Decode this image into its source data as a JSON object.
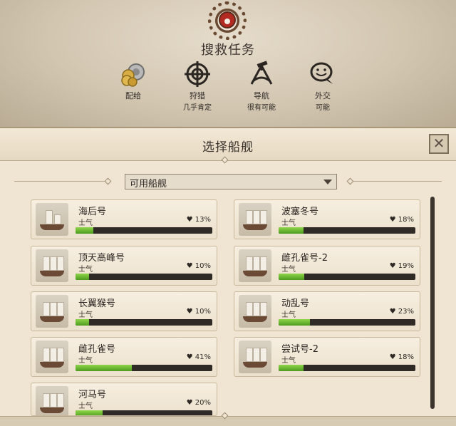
{
  "mission": {
    "title": "搜救任务",
    "stats": [
      {
        "label": "配给",
        "sub": "",
        "icon": "supplies-icon"
      },
      {
        "label": "狩猎",
        "sub": "几乎肯定",
        "icon": "crosshair-icon"
      },
      {
        "label": "导航",
        "sub": "很有可能",
        "icon": "sextant-icon"
      },
      {
        "label": "外交",
        "sub": "可能",
        "icon": "speech-bubble-icon"
      }
    ]
  },
  "panel": {
    "title": "选择船舰",
    "close_label": "✕",
    "filter": "可用船舰"
  },
  "morale_label": "士气",
  "ships": [
    {
      "name": "海后号",
      "morale": "13%",
      "fill": 0.13
    },
    {
      "name": "波塞冬号",
      "morale": "18%",
      "fill": 0.18
    },
    {
      "name": "顶天高峰号",
      "morale": "10%",
      "fill": 0.1
    },
    {
      "name": "雌孔雀号-2",
      "morale": "19%",
      "fill": 0.19
    },
    {
      "name": "长翼猴号",
      "morale": "10%",
      "fill": 0.1
    },
    {
      "name": "动乱号",
      "morale": "23%",
      "fill": 0.23
    },
    {
      "name": "雌孔雀号",
      "morale": "41%",
      "fill": 0.41
    },
    {
      "name": "尝试号-2",
      "morale": "18%",
      "fill": 0.18
    },
    {
      "name": "河马号",
      "morale": "20%",
      "fill": 0.2
    }
  ],
  "colors": {
    "bar_fill": "#6fbe34",
    "panel_bg": "#efe5d2"
  }
}
